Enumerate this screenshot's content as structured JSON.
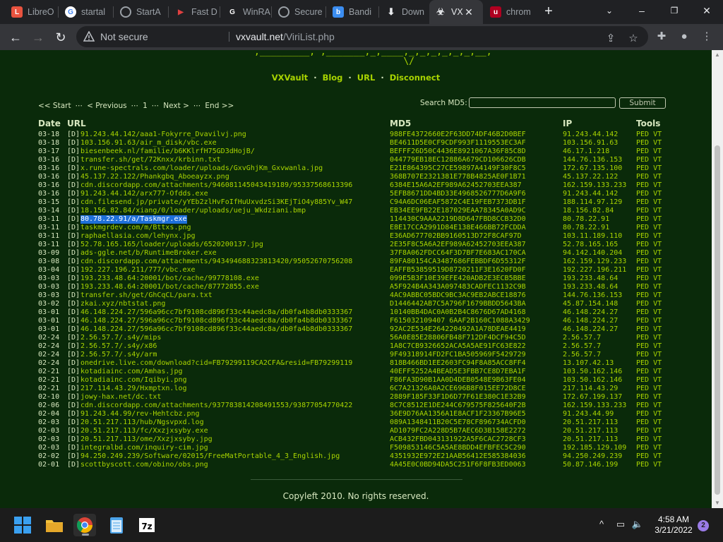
{
  "browser": {
    "tabs": [
      {
        "label": "LibreO",
        "icon": "libreoffice-icon",
        "color": "#e8533f"
      },
      {
        "label": "startal",
        "icon": "google-icon",
        "color": "#ffffff"
      },
      {
        "label": "StartA",
        "icon": "globe-icon",
        "color": "#9aa0a6"
      },
      {
        "label": "Fast D",
        "icon": "fast-download-icon",
        "color": "#e04040"
      },
      {
        "label": "WinRA",
        "icon": "github-icon",
        "color": "#ffffff"
      },
      {
        "label": "Secure",
        "icon": "globe-icon",
        "color": "#9aa0a6"
      },
      {
        "label": "Bandi",
        "icon": "bandicam-icon",
        "color": "#3b8df0"
      },
      {
        "label": "Down",
        "icon": "download-icon",
        "color": "#e8eaed"
      },
      {
        "label": "VX",
        "icon": "biohazard-icon",
        "color": "#e8eaed",
        "active": true
      },
      {
        "label": "chrom",
        "icon": "ublock-icon",
        "color": "#b00020"
      }
    ],
    "not_secure": "Not secure",
    "url_host": "vxvault.net",
    "url_path": "/ViriList.php"
  },
  "page": {
    "nav": [
      "VXVault",
      "Blog",
      "URL",
      "Disconnect"
    ],
    "pager": {
      "start": "<< Start",
      "previous": "< Previous",
      "page": "1",
      "next": "Next >",
      "end": "End >>",
      "sep": "⋯"
    },
    "search_label": "Search MD5:",
    "search_placeholder": "",
    "submit_label": "Submit",
    "columns": {
      "date": "Date",
      "url": "URL",
      "md5": "MD5",
      "ip": "IP",
      "tools": "Tools"
    },
    "rows": [
      {
        "date": "03-18",
        "url": "91.243.44.142/aaa1-Fokyrre_Dvavilvj.png",
        "md5": "988FE4372660E2F63DD74DF46B2D0BEF",
        "ip": "91.243.44.142"
      },
      {
        "date": "03-18",
        "url": "103.156.91.63/air_m_disk/vbc.exe",
        "md5": "BE4611D5E0CF9CDF993F1119553EC3AF",
        "ip": "103.156.91.63"
      },
      {
        "date": "03-17",
        "url": "biesenbeek.nl/familie/b6KKlrfH75GD3dHojB/",
        "md5": "BEFFF26D50C4436E8921067A36F85C8D",
        "ip": "46.17.1.218"
      },
      {
        "date": "03-16",
        "url": "transfer.sh/get/72Knxx/krbinn.txt",
        "md5": "044779EB18EC12886A679CD106626CDB",
        "ip": "144.76.136.153"
      },
      {
        "date": "03-16",
        "url": "x.rune-spectrals.com/loader/uploads/GxvGhjKm_Gxvwanla.jpg",
        "md5": "E21E864395C27CE59897A4149F30F8C5",
        "ip": "172.67.135.100"
      },
      {
        "date": "03-16",
        "url": "45.137.22.122/Phankgbq_Aboeayzx.png",
        "md5": "368B707E2321381E778B4825AE0F1B71",
        "ip": "45.137.22.122"
      },
      {
        "date": "03-16",
        "url": "cdn.discordapp.com/attachments/946081145043419189/95337568613396",
        "md5": "6384E15A6A2EF989A62452703EEA387",
        "ip": "162.159.133.233"
      },
      {
        "date": "03-16",
        "url": "91.243.44.142/arx777-Ofdds.exe",
        "md5": "5EFB8671DD4BD33E4968526777D6A9F6",
        "ip": "91.243.44.142"
      },
      {
        "date": "03-15",
        "url": "cdn.filesend.jp/private/yYEb2zlHvFoIfHuUxvdzSi3KEjTiO4y885Yv_W47",
        "md5": "C94A6DC06EAF5872C4E19FEB7373DB1F",
        "ip": "188.114.97.129"
      },
      {
        "date": "03-14",
        "url": "18.156.82.84/xiang/0/loader/uploads/ueju_Wkdziani.bmp",
        "md5": "EB34EE9FB22E187029EAA78345A0AD9C",
        "ip": "18.156.82.84"
      },
      {
        "date": "03-11",
        "url": "80.78.22.91/a/Taskmgr.exe",
        "md5": "114430C9AAA2219D8D647FBD8CCB32D0",
        "ip": "80.78.22.91",
        "selected": true
      },
      {
        "date": "03-11",
        "url": "taskmgrdev.com/m/Bttxs.png",
        "md5": "E8E17CCA2991D84E138E466BB72FCDDA",
        "ip": "80.78.22.91"
      },
      {
        "date": "03-11",
        "url": "raphaellasia.com/lehynx.jpg",
        "md5": "E36AD677702BB9160513D72F8CAF97D",
        "ip": "103.11.189.110"
      },
      {
        "date": "03-11",
        "url": "52.78.165.165/loader/uploads/6520200137.jpg",
        "md5": "2E35F8C5A6A2EF989A62452703EEA387",
        "ip": "52.78.165.165"
      },
      {
        "date": "03-09",
        "url": "ads-ggle.net/b/RuntimeBroker.exe",
        "md5": "37F8A062FDCC64F3D7BF7E683AC170CA",
        "ip": "94.142.140.204"
      },
      {
        "date": "03-08",
        "url": "cdn.discordapp.com/attachments/943494688323813420/95052670756208",
        "md5": "89FA80154CA3487686FEBBDF6D55312F",
        "ip": "162.159.129.233"
      },
      {
        "date": "03-04",
        "url": "192.227.196.211/777/vbc.exe",
        "md5": "EAFFB53859519D8720211F3E1620FD0F",
        "ip": "192.227.196.211"
      },
      {
        "date": "03-03",
        "url": "193.233.48.64:20001/bot/cache/99778108.exe",
        "md5": "099E5B3F10E39EFE420ADB2E3ECB5BBE",
        "ip": "193.233.48.64"
      },
      {
        "date": "03-03",
        "url": "193.233.48.64:20001/bot/cache/87772855.exe",
        "md5": "A5F924B4A343A097483CADFEC1132C9B",
        "ip": "193.233.48.64"
      },
      {
        "date": "03-03",
        "url": "transfer.sh/get/GhCqCL/para.txt",
        "md5": "4AC9ABBC05BDC9BC3AC9EB2ABCE18876",
        "ip": "144.76.136.153"
      },
      {
        "date": "03-02",
        "url": "zkai.xyz/nbtstat.png",
        "md5": "D1446442AB7C5A796F1679BBDD5643BA",
        "ip": "45.87.154.148"
      },
      {
        "date": "03-01",
        "url": "46.148.224.27/596a96cc7bf9108cd896f33c44aedc8a/db0fa4b8db0333367",
        "md5": "10140BB4DAC0A0B2B4C8676D67AD4168",
        "ip": "46.148.224.27"
      },
      {
        "date": "03-01",
        "url": "46.148.224.27/596a96cc7bf9108cd896f33c44aedc8a/db0fa4b8db0333367",
        "md5": "F615032109407 6AAF2B160C1088A3429",
        "ip": "46.148.224.27"
      },
      {
        "date": "03-01",
        "url": "46.148.224.27/596a96cc7bf9108cd896f33c44aedc8a/db0fa4b8db0333367",
        "md5": "92AC2E534E264220492A1A78DEAE4419",
        "ip": "46.148.224.27"
      },
      {
        "date": "02-24",
        "url": "2.56.57.7/.s4y/mips",
        "md5": "56A0E85E28806FB48F712DF4DCF94C5D",
        "ip": "2.56.57.7"
      },
      {
        "date": "02-24",
        "url": "2.56.57.7/.s4y/x86",
        "md5": "1A8C7CB9326652ACA5A5AE91FC63E822",
        "ip": "2.56.57.7"
      },
      {
        "date": "02-24",
        "url": "2.56.57.7/.s4y/arm",
        "md5": "9F49318914FD2FC1BA505969F5429729",
        "ip": "2.56.57.7"
      },
      {
        "date": "02-24",
        "url": "onedrive.live.com/download?cid=FB79299119CA2CFA&resid=FB79299119",
        "md5": "818B466BD1EE2603FC94F8A85ACC8FF4",
        "ip": "13.107.42.13"
      },
      {
        "date": "02-21",
        "url": "kotadiainc.com/Amhas.jpg",
        "md5": "40EFF5252A4BEAD5E3FBB7CE8D7EBA1F",
        "ip": "103.50.162.146"
      },
      {
        "date": "02-21",
        "url": "kotadiainc.com/Iqibyi.png",
        "md5": "F86FA3D90B1AA0D4DEB0548E9B63FE04",
        "ip": "103.50.162.146"
      },
      {
        "date": "02-21",
        "url": "217.114.43.29/Hxmptxn.log",
        "md5": "6C7A21326A0A2CE696B8F015EE72D8CE",
        "ip": "217.114.43.29"
      },
      {
        "date": "02-10",
        "url": "jowy-hax.net/dc.txt",
        "md5": "2889F185F33F1D6D77F61E380C1E32B9",
        "ip": "172.67.199.137"
      },
      {
        "date": "02-06",
        "url": "cdn.discordapp.com/attachments/937783814208491553/93877054770422",
        "md5": "8C7C8512E1DE244C679575F825640F2B",
        "ip": "162.159.133.233"
      },
      {
        "date": "02-04",
        "url": "91.243.44.99/rev-Hehtcbz.png",
        "md5": "36E9D76AA1356A1E8ACF1F23367B96E5",
        "ip": "91.243.44.99"
      },
      {
        "date": "02-03",
        "url": "20.51.217.113/hub/Ngsvpxd.log",
        "md5": "089A1348411B20C5E78CF896734ACFD0",
        "ip": "20.51.217.113"
      },
      {
        "date": "02-03",
        "url": "20.51.217.113/fc/Xxzjxsyby.exe",
        "md5": "AD1079FC2A228D5B7AEC6D3B158E2272",
        "ip": "20.51.217.113"
      },
      {
        "date": "02-03",
        "url": "20.51.217.113/ome/Xxzjxsyby.jpg",
        "md5": "ACB432FBD043131922A5F6CAC2728CF3",
        "ip": "20.51.217.113"
      },
      {
        "date": "02-03",
        "url": "integralbd.com/inquiry-cim.jpg",
        "md5": "F509853146C5A5AE8BDD4EFBFEC5C290",
        "ip": "192.185.129.109"
      },
      {
        "date": "02-02",
        "url": "94.250.249.239/Software/02015/FreeMatPortable_4_3_English.jpg",
        "md5": "4351932E972E21AAB56412E585384036",
        "ip": "94.250.249.239"
      },
      {
        "date": "02-01",
        "url": "scottbyscott.com/obino/obs.png",
        "md5": "4A45E0C0BD94DA5C251F6F8FB3ED0063",
        "ip": "50.87.146.199"
      }
    ],
    "row_prefix": "[D]",
    "tools": "PED VT",
    "footer": "Copyleft 2010. No rights reserved."
  },
  "taskbar": {
    "time": "4:58 AM",
    "date": "3/21/2022",
    "notifications": "2",
    "apps": [
      "windows-start",
      "file-explorer",
      "chrome",
      "notepad",
      "7zip"
    ]
  },
  "colors": {
    "page_bg": "#0a2a0a",
    "link": "#a8d400",
    "text": "#d8e8c0",
    "selection": "#1e6fd9"
  }
}
